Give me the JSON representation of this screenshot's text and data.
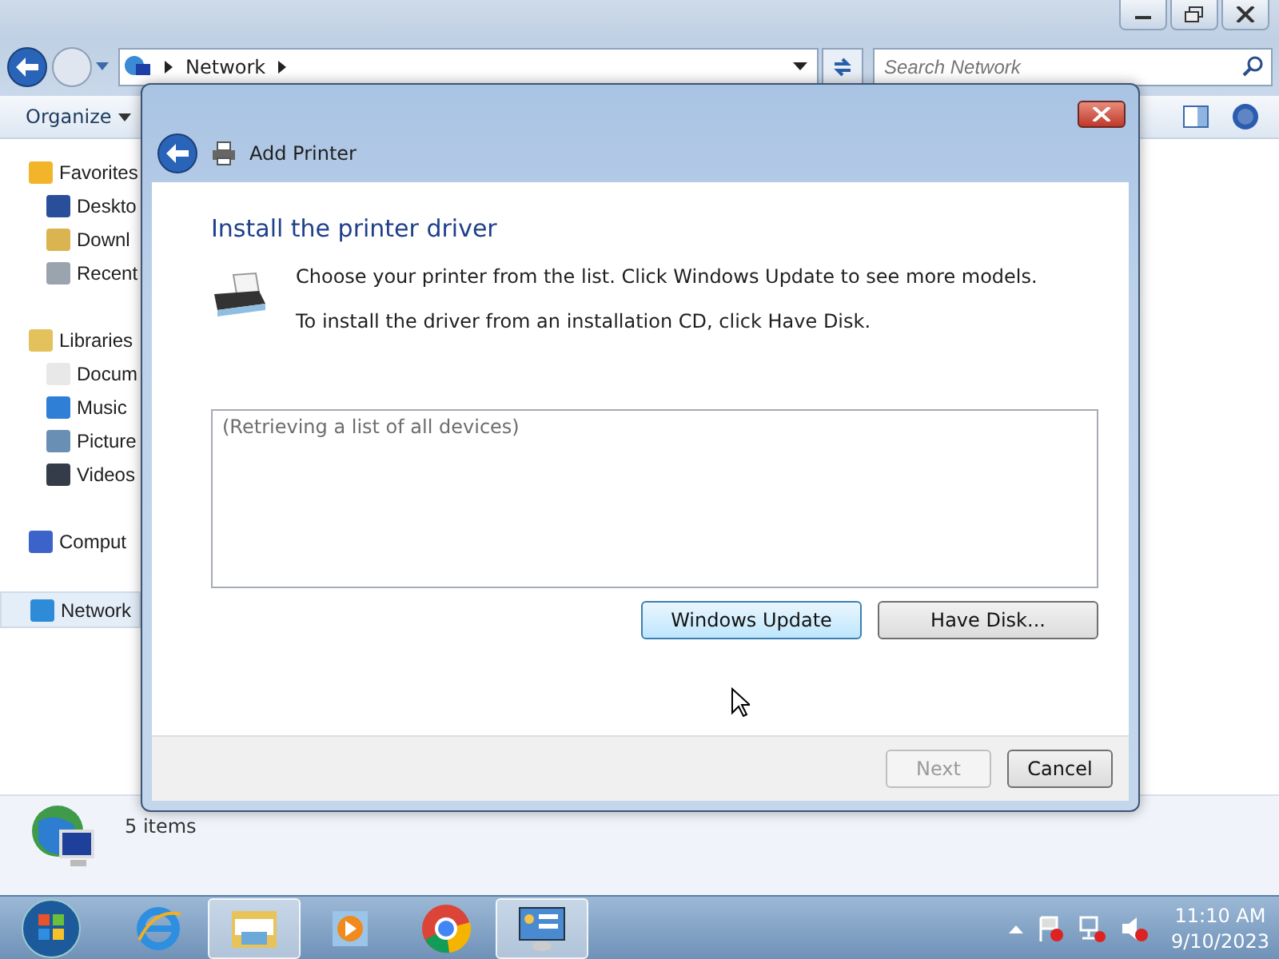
{
  "explorer": {
    "address": {
      "segments": [
        "Network"
      ]
    },
    "search": {
      "placeholder": "Search Network"
    },
    "toolbar": {
      "organize": "Organize"
    },
    "sidebar": {
      "groups": [
        {
          "label": "Favorites",
          "kind": "star",
          "selected": false,
          "children": [
            {
              "label": "Deskto",
              "kind": "desktop",
              "selected": false
            },
            {
              "label": "Downl",
              "kind": "download",
              "selected": false
            },
            {
              "label": "Recent",
              "kind": "recent",
              "selected": false
            }
          ]
        },
        {
          "label": "Libraries",
          "kind": "library",
          "selected": false,
          "children": [
            {
              "label": "Docum",
              "kind": "document",
              "selected": false
            },
            {
              "label": "Music",
              "kind": "music",
              "selected": false
            },
            {
              "label": "Picture",
              "kind": "picture",
              "selected": false
            },
            {
              "label": "Videos",
              "kind": "video",
              "selected": false
            }
          ]
        },
        {
          "label": "Comput",
          "kind": "computer",
          "selected": false
        },
        {
          "label": "Network",
          "kind": "network",
          "selected": true
        }
      ]
    },
    "status": {
      "count": "5 items"
    }
  },
  "dialog": {
    "title": "Add Printer",
    "heading": "Install the printer driver",
    "lines": [
      "Choose your printer from the list. Click Windows Update to see more models.",
      "To install the driver from an installation CD, click Have Disk."
    ],
    "list": {
      "placeholder": "(Retrieving a list of all devices)"
    },
    "buttons": [
      {
        "label": "Windows Update",
        "focused": true
      },
      {
        "label": "Have Disk...",
        "focused": false
      }
    ],
    "footer": [
      {
        "label": "Next",
        "disabled": true
      },
      {
        "label": "Cancel",
        "disabled": false
      }
    ]
  },
  "taskbar": {
    "items": [
      {
        "kind": "ie",
        "selected": false
      },
      {
        "kind": "explorer",
        "selected": true
      },
      {
        "kind": "media",
        "selected": false
      },
      {
        "kind": "chrome",
        "selected": false
      },
      {
        "kind": "control",
        "selected": true
      }
    ],
    "tray": {
      "time": "11:10 AM",
      "date": "9/10/2023"
    }
  }
}
